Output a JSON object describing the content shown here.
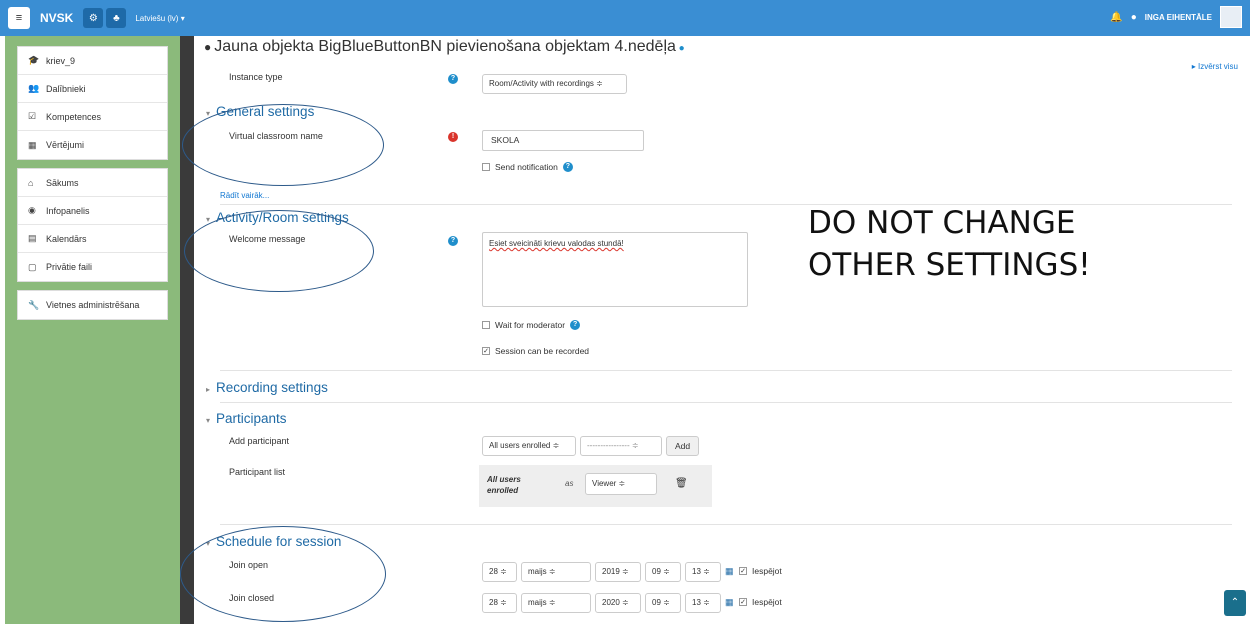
{
  "navbar": {
    "brand": "NVSK",
    "language": "Latviešu (lv) ▾",
    "user_name": "INGA EIHENTĀLE"
  },
  "sidebar": {
    "group1": [
      {
        "label": "kriev_9",
        "icon": "graduation-cap-icon"
      },
      {
        "label": "Dalībnieki",
        "icon": "users-icon"
      },
      {
        "label": "Kompetences",
        "icon": "checkbox-icon"
      },
      {
        "label": "Vērtējumi",
        "icon": "table-icon"
      }
    ],
    "group2": [
      {
        "label": "Sākums",
        "icon": "home-icon"
      },
      {
        "label": "Infopanelis",
        "icon": "dashboard-icon"
      },
      {
        "label": "Kalendārs",
        "icon": "calendar-icon"
      },
      {
        "label": "Privātie faili",
        "icon": "file-icon"
      }
    ],
    "group3": [
      {
        "label": "Vietnes administrēšana",
        "icon": "wrench-icon"
      }
    ]
  },
  "page": {
    "title": "Jauna objekta BigBlueButtonBN pievienošana objektam 4.nedēļa",
    "expand_all": "Izvērst visu"
  },
  "form": {
    "instance_type_label": "Instance type",
    "instance_type_value": "Room/Activity with recordings ≑",
    "general_settings": "General settings",
    "classroom_name_label": "Virtual classroom name",
    "classroom_name_value": "SKOLA",
    "send_notification": "Send notification",
    "show_more": "Rādīt vairāk...",
    "activity_room_settings": "Activity/Room settings",
    "welcome_label": "Welcome message",
    "welcome_value": "Esiet sveicināti krievu valodas stundā!",
    "wait_moderator": "Wait for moderator",
    "session_recorded": "Session can be recorded",
    "recording_settings": "Recording settings",
    "participants": "Participants",
    "add_participant_label": "Add participant",
    "add_participant_select": "All users enrolled ≑",
    "add_participant_select2": "---------------- ≑",
    "add_button": "Add",
    "participant_list_label": "Participant list",
    "plist_name": "All users enrolled",
    "plist_as": "as",
    "plist_role": "Viewer ≑",
    "schedule": "Schedule for session",
    "join_open_label": "Join open",
    "join_closed_label": "Join closed",
    "open_day": "28 ≑",
    "open_month": "maijs ≑",
    "open_year": "2019 ≑",
    "open_hour": "09 ≑",
    "open_min": "13 ≑",
    "closed_day": "28 ≑",
    "closed_month": "maijs ≑",
    "closed_year": "2020 ≑",
    "closed_hour": "09 ≑",
    "closed_min": "13 ≑",
    "enable": "Iespējot"
  },
  "overlay": {
    "line1": "DO NOT CHANGE",
    "line2": "OTHER SETTINGS!"
  }
}
